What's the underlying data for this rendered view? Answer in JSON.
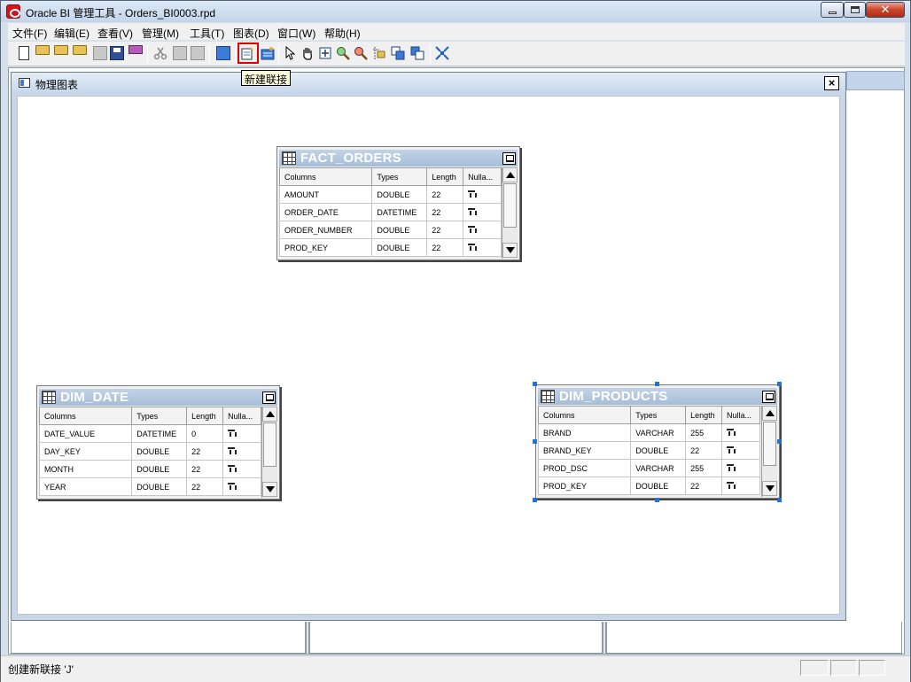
{
  "window": {
    "title": "Oracle BI 管理工具 - Orders_BI0003.rpd"
  },
  "menu": {
    "items": [
      "文件(F)",
      "编辑(E)",
      "查看(V)",
      "管理(M)",
      "工具(T)",
      "图表(D)",
      "窗口(W)",
      "帮助(H)"
    ]
  },
  "tooltip": {
    "text": "新建联接"
  },
  "child_window": {
    "title": "物理图表",
    "close": "×"
  },
  "grid_headers": [
    "Columns",
    "Types",
    "Length",
    "Nulla..."
  ],
  "tables": [
    {
      "name": "FACT_ORDERS",
      "rows": [
        [
          "AMOUNT",
          "DOUBLE",
          "22"
        ],
        [
          "ORDER_DATE",
          "DATETIME",
          "22"
        ],
        [
          "ORDER_NUMBER",
          "DOUBLE",
          "22"
        ],
        [
          "PROD_KEY",
          "DOUBLE",
          "22"
        ]
      ],
      "selected": false
    },
    {
      "name": "DIM_DATE",
      "rows": [
        [
          "DATE_VALUE",
          "DATETIME",
          "0"
        ],
        [
          "DAY_KEY",
          "DOUBLE",
          "22"
        ],
        [
          "MONTH",
          "DOUBLE",
          "22"
        ],
        [
          "YEAR",
          "DOUBLE",
          "22"
        ]
      ],
      "selected": false
    },
    {
      "name": "DIM_PRODUCTS",
      "rows": [
        [
          "BRAND",
          "VARCHAR",
          "255"
        ],
        [
          "BRAND_KEY",
          "DOUBLE",
          "22"
        ],
        [
          "PROD_DSC",
          "VARCHAR",
          "255"
        ],
        [
          "PROD_KEY",
          "DOUBLE",
          "22"
        ]
      ],
      "selected": true
    }
  ],
  "status": {
    "text": "创建新联接 'J'"
  },
  "colors": {
    "selection_handle": "#1f73d6",
    "highlight_outline": "#e00000",
    "table_header_text": "#ffffff"
  }
}
